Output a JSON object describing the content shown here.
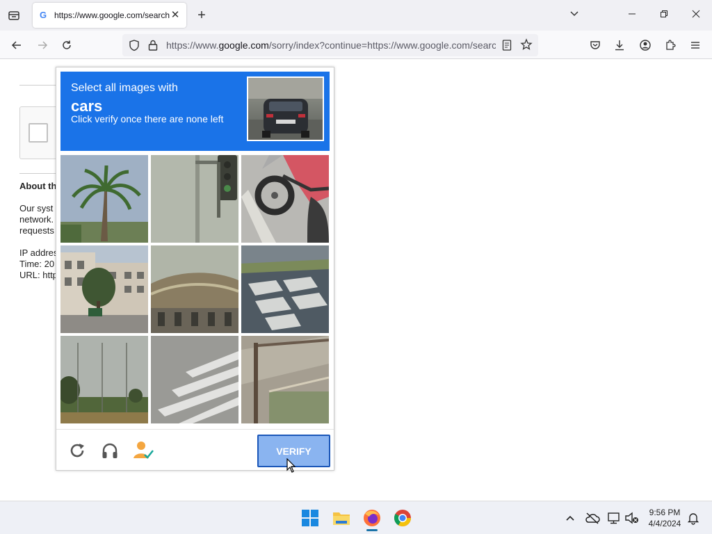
{
  "browser": {
    "tab_title": "https://www.google.com/search",
    "url_prefix": "https://www.",
    "url_domain": "google.com",
    "url_rest": "/sorry/index?continue=https://www.google.com/search"
  },
  "page": {
    "about_title": "About th",
    "about_lines": [
      "Our syst",
      "network.",
      "requests"
    ],
    "info_lines": [
      "IP addres",
      "Time: 20",
      "URL: http"
    ]
  },
  "captcha": {
    "instruction_line1": "Select all images with",
    "target_word": "cars",
    "instruction_line3": "Click verify once there are none left",
    "verify_label": "VERIFY",
    "tiles": [
      "palm-tree",
      "traffic-light",
      "motorcycle",
      "buildings",
      "bridge",
      "crosswalk-shadow",
      "fence-trees",
      "crosswalk-stripes",
      "grass-pole"
    ],
    "colors": {
      "header": "#1a73e8",
      "verify_bg": "#8ab4f0",
      "verify_border": "#1a56b8"
    }
  },
  "taskbar": {
    "time": "9:56 PM",
    "date": "4/4/2024"
  }
}
